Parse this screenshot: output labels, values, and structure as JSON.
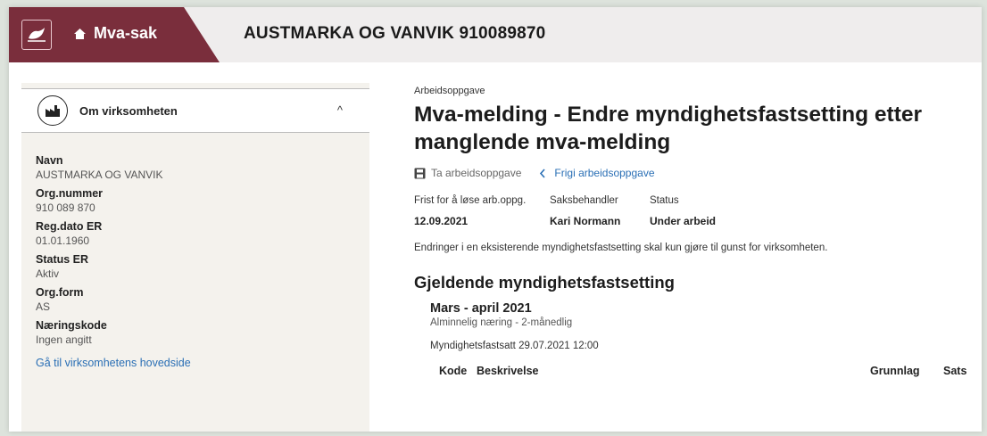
{
  "header": {
    "home_label": "Mva-sak",
    "company_title": "AUSTMARKA OG VANVIK 910089870"
  },
  "sidebar": {
    "section_title": "Om virksomheten",
    "fields": [
      {
        "label": "Navn",
        "value": "AUSTMARKA OG VANVIK"
      },
      {
        "label": "Org.nummer",
        "value": "910 089 870"
      },
      {
        "label": "Reg.dato ER",
        "value": "01.01.1960"
      },
      {
        "label": "Status ER",
        "value": "Aktiv"
      },
      {
        "label": "Org.form",
        "value": "AS"
      },
      {
        "label": "Næringskode",
        "value": "Ingen angitt"
      }
    ],
    "main_page_link": "Gå til virksomhetens hovedside"
  },
  "task": {
    "eyebrow": "Arbeidsoppgave",
    "title": "Mva-melding - Endre myndighetsfastsetting etter manglende mva-melding",
    "take_action": "Ta arbeidsoppgave",
    "release_action": "Frigi arbeidsoppgave",
    "meta": {
      "deadline_label": "Frist for å løse arb.oppg.",
      "deadline_value": "12.09.2021",
      "handler_label": "Saksbehandler",
      "handler_value": "Kari Normann",
      "status_label": "Status",
      "status_value": "Under arbeid"
    },
    "notice": "Endringer i en eksisterende myndighetsfastsetting skal kun gjøre til gunst for virksomheten."
  },
  "current": {
    "heading": "Gjeldende myndighetsfastsetting",
    "period_title": "Mars - april 2021",
    "period_sub": "Alminnelig næring - 2-månedlig",
    "fixed_line": "Myndighetsfastsatt 29.07.2021 12:00",
    "columns": [
      "Kode",
      "Beskrivelse",
      "Grunnlag",
      "Sats"
    ]
  },
  "colors": {
    "brand": "#7a2e3c",
    "link": "#2a6fb5",
    "sidebar_bg": "#f4f2ed"
  }
}
